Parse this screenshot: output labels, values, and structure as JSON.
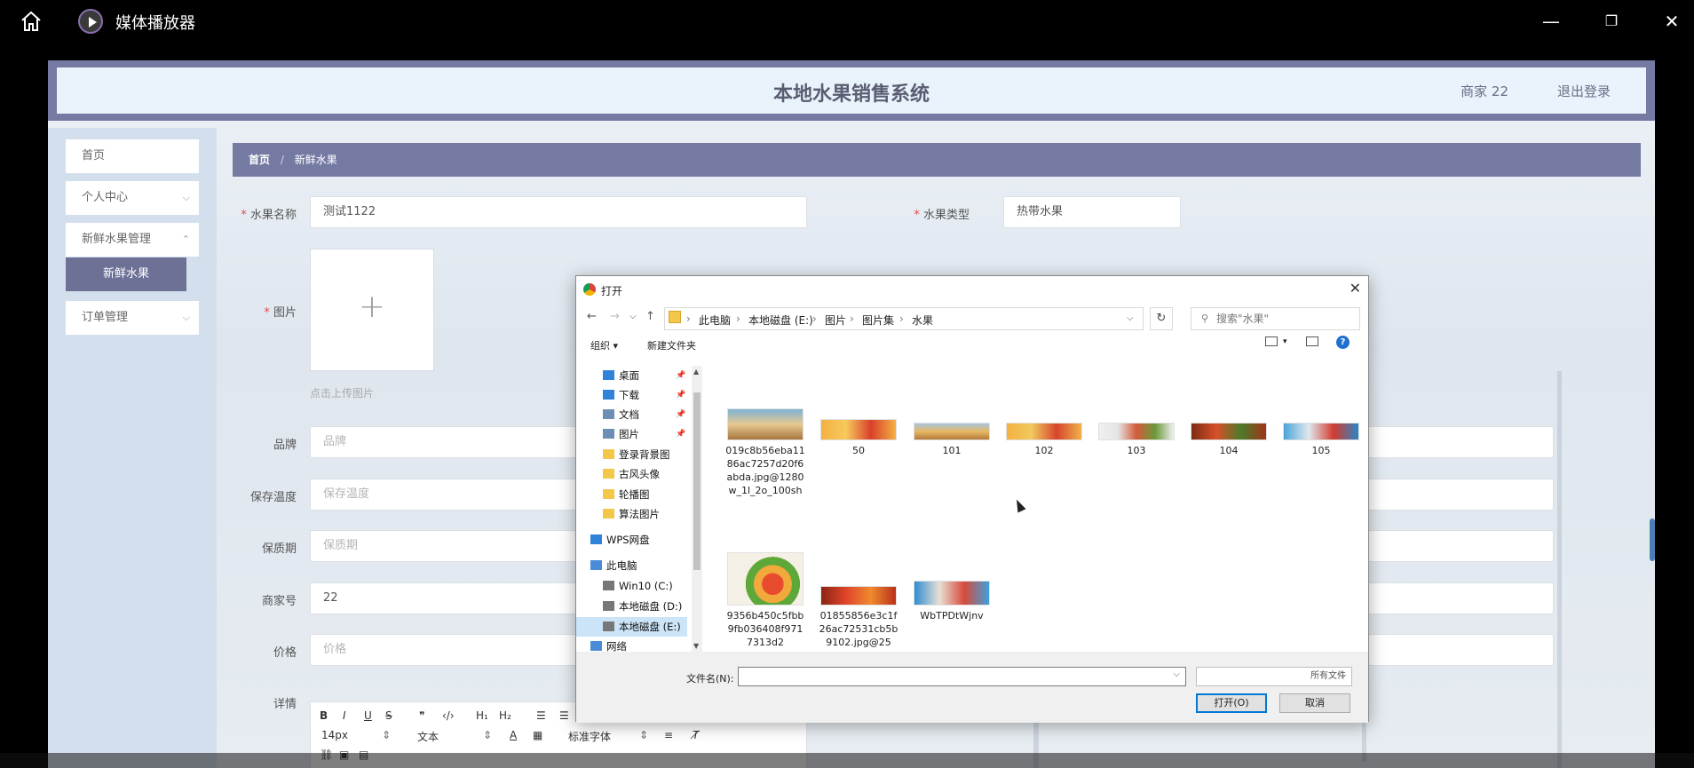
{
  "player": {
    "title": "媒体播放器"
  },
  "app": {
    "title": "本地水果销售系统",
    "user": "商家 22",
    "logout": "退出登录"
  },
  "sidebar": {
    "items": [
      {
        "label": "首页"
      },
      {
        "label": "个人中心"
      },
      {
        "label": "新鲜水果管理"
      },
      {
        "label": "订单管理"
      }
    ],
    "active": "新鲜水果"
  },
  "breadcrumb": {
    "home": "首页",
    "sep": "/",
    "current": "新鲜水果"
  },
  "form": {
    "name_label": "水果名称",
    "name_value": "测试1122",
    "type_label": "水果类型",
    "type_value": "热带水果",
    "image_label": "图片",
    "upload_hint": "点击上传图片",
    "brand_label": "品牌",
    "brand_placeholder": "品牌",
    "temp_label": "保存温度",
    "temp_placeholder": "保存温度",
    "shelf_label": "保质期",
    "shelf_placeholder": "保质期",
    "merchant_label": "商家号",
    "merchant_value": "22",
    "price_label": "价格",
    "price_placeholder": "价格",
    "detail_label": "详情"
  },
  "editor": {
    "font_size": "14px",
    "para": "文本",
    "font": "标准字体"
  },
  "dialog": {
    "title": "打开",
    "path": [
      "此电脑",
      "本地磁盘 (E:)",
      "图片",
      "图片集",
      "水果"
    ],
    "search_placeholder": "搜索\"水果\"",
    "organize": "组织 ▾",
    "new_folder": "新建文件夹",
    "tree": [
      {
        "label": "桌面",
        "icon": "desktop-icon"
      },
      {
        "label": "下载",
        "icon": "download-icon"
      },
      {
        "label": "文档",
        "icon": "document-icon"
      },
      {
        "label": "图片",
        "icon": "pictures-icon"
      },
      {
        "label": "登录背景图",
        "icon": "folder-icon"
      },
      {
        "label": "古风头像",
        "icon": "folder-icon"
      },
      {
        "label": "轮播图",
        "icon": "folder-icon"
      },
      {
        "label": "算法图片",
        "icon": "folder-icon"
      },
      {
        "label": "WPS网盘",
        "icon": "cloud-icon"
      },
      {
        "label": "此电脑",
        "icon": "computer-icon"
      },
      {
        "label": "Win10 (C:)",
        "icon": "drive-icon"
      },
      {
        "label": "本地磁盘 (D:)",
        "icon": "drive-icon"
      },
      {
        "label": "本地磁盘 (E:)",
        "icon": "drive-icon"
      },
      {
        "label": "网络",
        "icon": "network-icon"
      }
    ],
    "files": [
      {
        "name": "019c8b56eba1186ac7257d20f6abda.jpg@1280w_1l_2o_100sh"
      },
      {
        "name": "50"
      },
      {
        "name": "101"
      },
      {
        "name": "102"
      },
      {
        "name": "103"
      },
      {
        "name": "104"
      },
      {
        "name": "105"
      },
      {
        "name": "9356b450c5fbb9fb036408f9717313d2"
      },
      {
        "name": "01855856e3c1f26ac72531cb5b9102.jpg@25"
      },
      {
        "name": "WbTPDtWjnv"
      }
    ],
    "filename_label": "文件名(N):",
    "filetype": "所有文件",
    "open_button": "打开(O)",
    "cancel_button": "取消"
  }
}
